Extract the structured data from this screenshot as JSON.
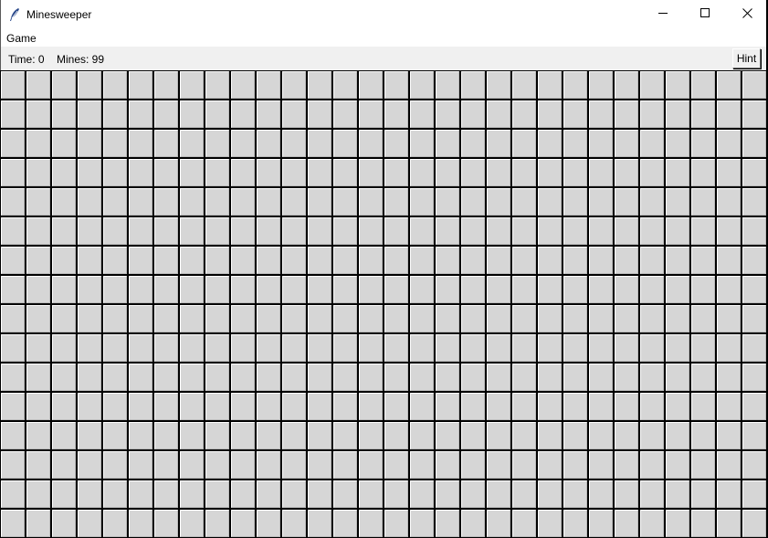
{
  "window": {
    "title": "Minesweeper",
    "icon": "feather-icon"
  },
  "menu": {
    "items": [
      {
        "label": "Game"
      }
    ]
  },
  "status": {
    "time_label": "Time: 0",
    "mines_label": "Mines: 99"
  },
  "toolbar": {
    "hint_label": "Hint"
  },
  "board": {
    "columns": 30,
    "rows": 16,
    "cell_state": "covered",
    "cell_color": "#d6d6d6",
    "grid_line_color": "#000000"
  },
  "controls": {
    "minimize_icon": "minimize-icon",
    "maximize_icon": "maximize-icon",
    "close_icon": "close-icon"
  }
}
